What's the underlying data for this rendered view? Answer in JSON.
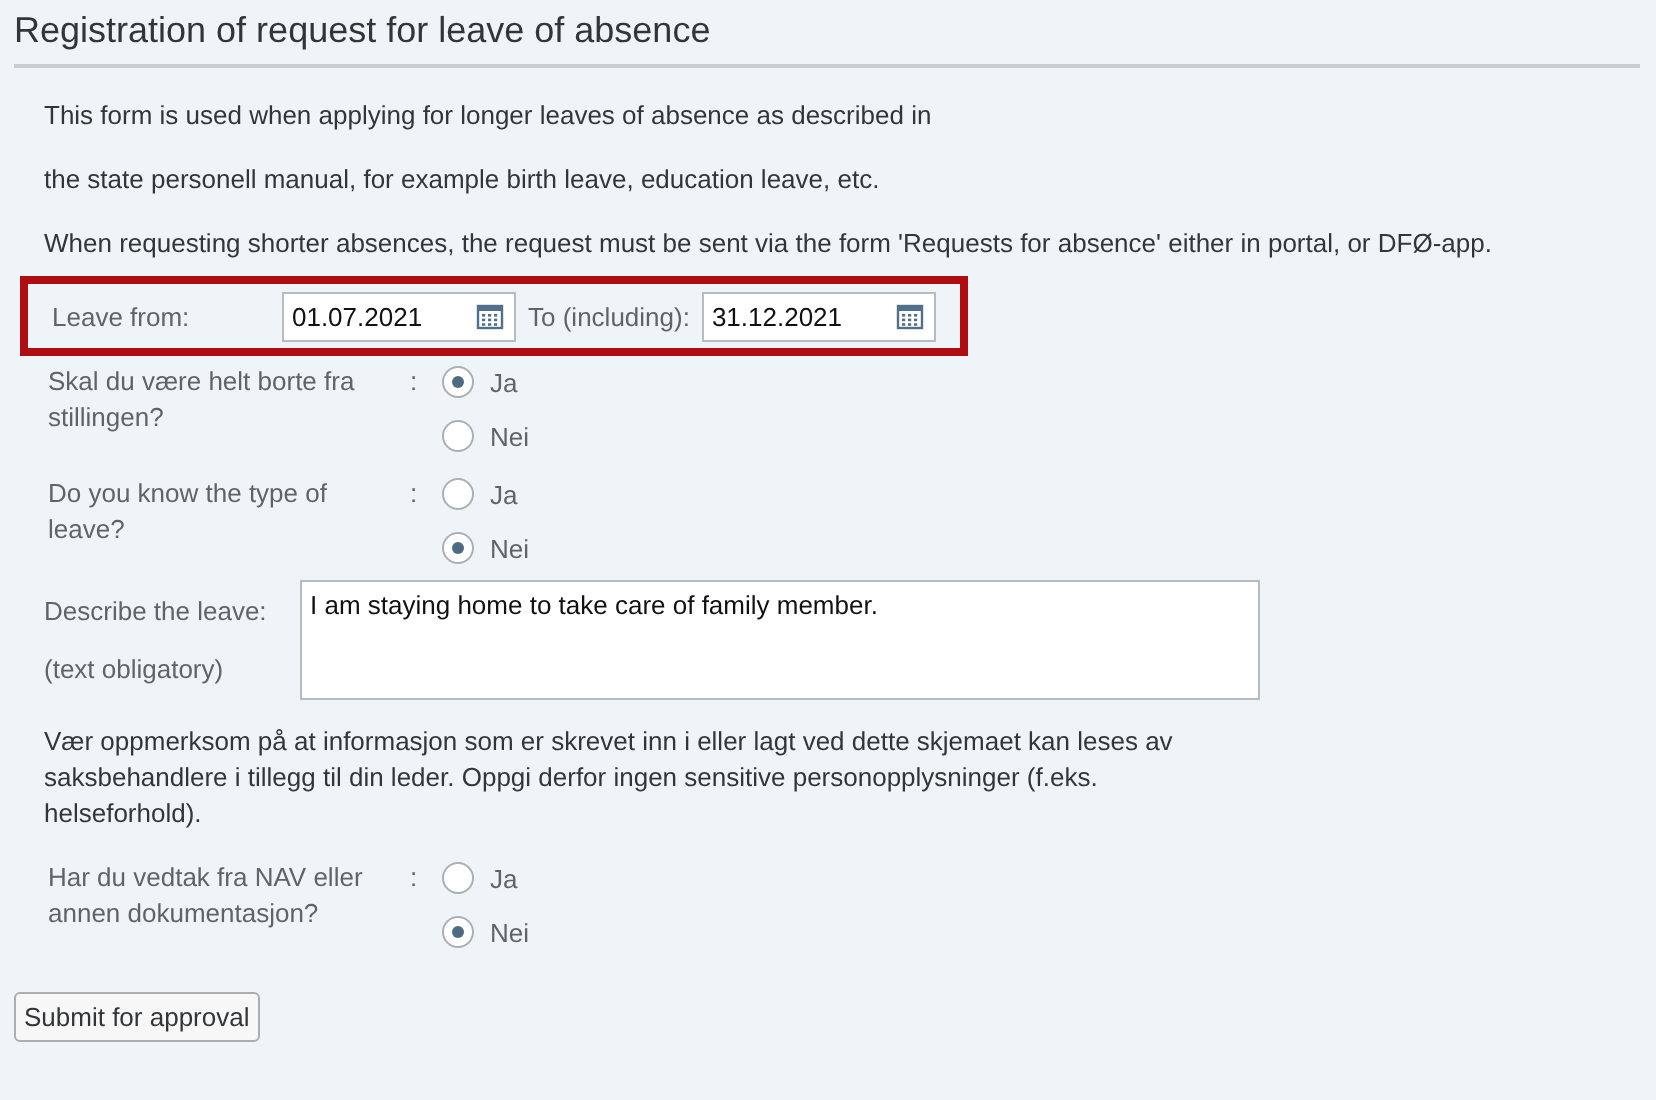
{
  "title": "Registration of request for leave of absence",
  "intro": [
    "This form is used when applying for longer leaves of absence as described in",
    "the state personell manual, for example birth leave, education leave, etc.",
    "When requesting shorter absences, the request must be sent via the form 'Requests for absence' either in portal, or DFØ-app."
  ],
  "period": {
    "highlighted": true,
    "from_label": "Leave from:",
    "from_value": "01.07.2021",
    "to_label": "To (including):",
    "to_value": "31.12.2021"
  },
  "questions_a": [
    {
      "label": "Skal du være helt borte fra stillingen?",
      "separator": ":",
      "options": [
        {
          "label": "Ja",
          "selected": true
        },
        {
          "label": "Nei",
          "selected": false
        }
      ]
    },
    {
      "label": "Do you know the type of leave?",
      "separator": ":",
      "options": [
        {
          "label": "Ja",
          "selected": false
        },
        {
          "label": "Nei",
          "selected": true
        }
      ]
    }
  ],
  "description": {
    "label": "Describe the leave:",
    "note": "(text obligatory)",
    "value": "I am staying home to take care of family member."
  },
  "notice": "Vær oppmerksom på at informasjon som er skrevet inn i eller lagt ved dette skjemaet kan leses av saksbehandlere i tillegg til din leder. Oppgi derfor ingen sensitive personopplysninger (f.eks. helseforhold).",
  "questions_b": [
    {
      "label": "Har du vedtak fra NAV eller annen dokumentasjon?",
      "separator": ":",
      "options": [
        {
          "label": "Ja",
          "selected": false
        },
        {
          "label": "Nei",
          "selected": true
        }
      ]
    }
  ],
  "submit": "Submit for approval"
}
